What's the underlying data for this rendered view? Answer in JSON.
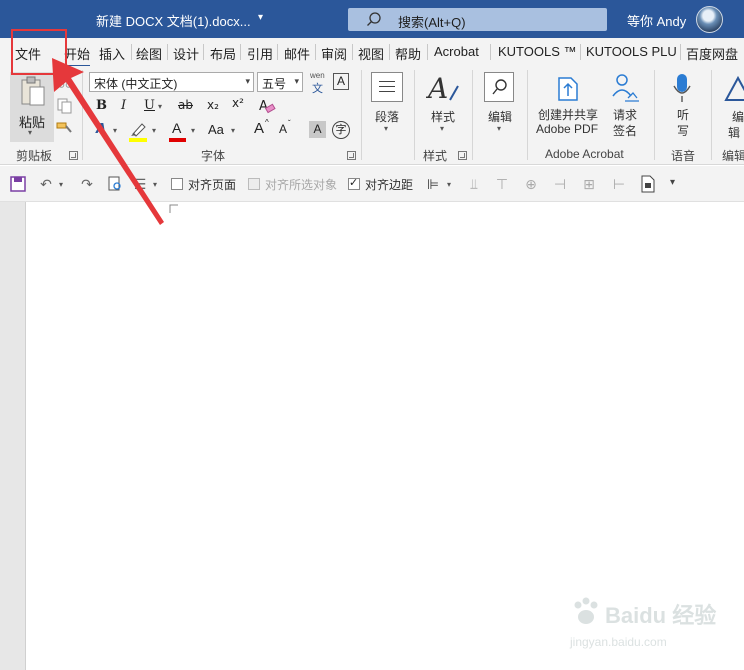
{
  "titlebar": {
    "doc_title": "新建 DOCX 文档(1).docx...",
    "search_placeholder": "搜索(Alt+Q)",
    "user_name": "等你 Andy"
  },
  "tabs": [
    "文件",
    "开始",
    "插入",
    "绘图",
    "设计",
    "布局",
    "引用",
    "邮件",
    "审阅",
    "视图",
    "帮助",
    "Acrobat",
    "KUTOOLS ™",
    "KUTOOLS PLU",
    "百度网盘"
  ],
  "ribbon": {
    "clipboard": {
      "paste_label": "粘贴",
      "group_label": "剪贴板"
    },
    "font": {
      "font_name": "宋体 (中文正文)",
      "font_size": "五号",
      "wen_label": "wen",
      "wen_char": "文",
      "char_border": "A",
      "bold": "B",
      "italic": "I",
      "underline": "U",
      "strike": "ab",
      "subscript": "x₂",
      "superscript": "x²",
      "grow": "A",
      "shrink": "A",
      "case": "Aa",
      "shade": "A",
      "enclose": "字",
      "group_label": "字体"
    },
    "paragraph": {
      "label": "段落"
    },
    "styles": {
      "label": "样式",
      "group_label": "样式"
    },
    "editing": {
      "label": "编辑"
    },
    "acrobat": {
      "create_share_1": "创建并共享",
      "create_share_2": "Adobe PDF",
      "request_1": "请求",
      "request_2": "签名",
      "group_label": "Adobe Acrobat"
    },
    "voice": {
      "listen_1": "听",
      "listen_2": "写",
      "group_label": "语音"
    },
    "edit_cut": {
      "label_1": "编",
      "label_2": "辑",
      "group_label": "编辑"
    }
  },
  "qat": {
    "align_page": "对齐页面",
    "align_selected": "对齐所选对象",
    "align_margin": "对齐边距"
  },
  "watermark": {
    "brand": "Baidu 经验",
    "url": "jingyan.baidu.com"
  },
  "colors": {
    "title_bar": "#2b579a",
    "ribbon": "#f3f3f3",
    "highlight": "#e5383b",
    "arrow": "#e5383b"
  }
}
